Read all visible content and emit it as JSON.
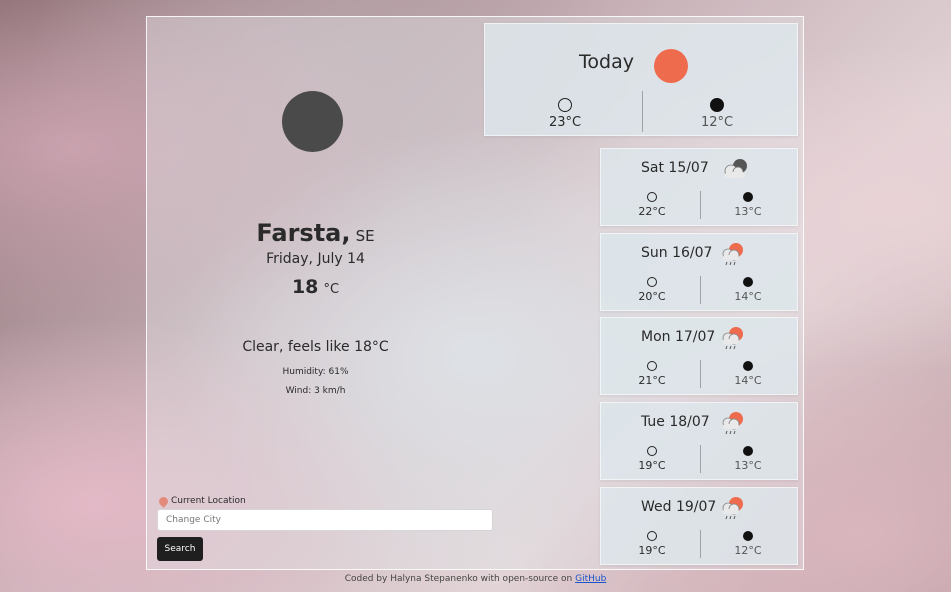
{
  "current": {
    "city": "Farsta,",
    "country": "SE",
    "date": "Friday, July 14",
    "temperature": "18",
    "unit": "°C",
    "description": "Clear, feels like 18°C",
    "humidity": "Humidity: 61%",
    "wind": "Wind: 3 km/h",
    "icon": "moon-icon"
  },
  "search": {
    "current_location_label": "Current Location",
    "placeholder": "Change City",
    "button_label": "Search"
  },
  "today": {
    "title": "Today",
    "icon": "sun-icon",
    "day_temp": "23°C",
    "night_temp": "12°C"
  },
  "forecast": [
    {
      "label": "Sat 15/07",
      "icon": "cloudy-icon",
      "day_temp": "22°C",
      "night_temp": "13°C"
    },
    {
      "label": "Sun 16/07",
      "icon": "sun-cloud-rain-icon",
      "day_temp": "20°C",
      "night_temp": "14°C"
    },
    {
      "label": "Mon 17/07",
      "icon": "sun-cloud-rain-icon",
      "day_temp": "21°C",
      "night_temp": "14°C"
    },
    {
      "label": "Tue 18/07",
      "icon": "sun-cloud-rain-icon",
      "day_temp": "19°C",
      "night_temp": "13°C"
    },
    {
      "label": "Wed 19/07",
      "icon": "sun-cloud-rain-icon",
      "day_temp": "19°C",
      "night_temp": "12°C"
    }
  ],
  "footer": {
    "text": "Coded by Halyna Stepanenko with open-source on ",
    "link": "GitHub"
  },
  "colors": {
    "accent_sun": "#ee6b4d",
    "moon": "#4a4a4a",
    "button": "#1f1f1f",
    "link": "#1a55cc"
  }
}
